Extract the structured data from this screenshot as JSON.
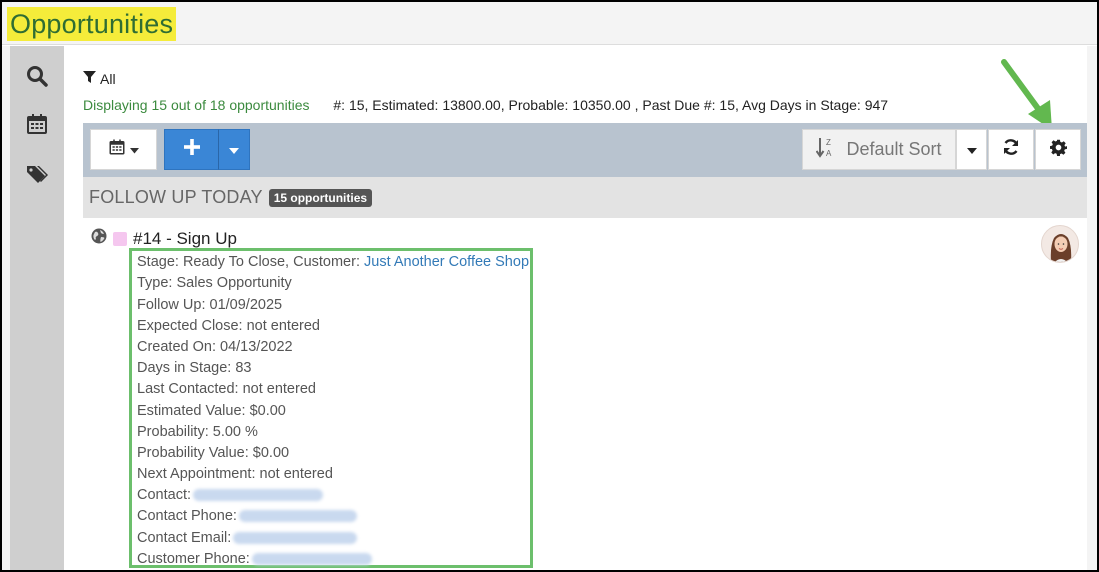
{
  "app": {
    "title": "Opportunities"
  },
  "filter": {
    "label": "All"
  },
  "summary": {
    "count_text": "Displaying 15 out of 18 opportunities",
    "stats_text": "#: 15, Estimated: 13800.00, Probable: 10350.00 , Past Due #: 15, Avg Days in Stage: 947"
  },
  "toolbar": {
    "sort_label": "Default Sort"
  },
  "section": {
    "title": "FOLLOW UP TODAY",
    "badge": "15 opportunities"
  },
  "opportunity": {
    "title": "#14 - Sign Up",
    "stage_prefix": "Stage: Ready To Close, Customer: ",
    "customer_link": "Just Another Coffee Shop",
    "type": "Type: Sales Opportunity",
    "follow_up": "Follow Up: 01/09/2025",
    "expected_close": "Expected Close: not entered",
    "created_on": "Created On: 04/13/2022",
    "days_in_stage": "Days in Stage: 83",
    "last_contacted": "Last Contacted: not entered",
    "estimated_value": "Estimated Value: $0.00",
    "probability": "Probability: 5.00 %",
    "probability_value": "Probability Value: $0.00",
    "next_appointment": "Next Appointment: not entered",
    "contact_label": "Contact:",
    "contact_phone_label": "Contact Phone:",
    "contact_email_label": "Contact Email:",
    "customer_phone_label": "Customer Phone:"
  },
  "colors": {
    "accent_green": "#6cbf6c",
    "title_highlight": "#f5ec3a",
    "primary_blue": "#3a86d6",
    "swatch_pink": "#f5c7ef"
  },
  "icons": {
    "rail": [
      "search-icon",
      "calendar-icon",
      "tags-icon"
    ],
    "toolbar": [
      "calendar-icon",
      "plus-icon",
      "caret-down-icon",
      "sort-alpha-icon",
      "refresh-icon",
      "gear-icon"
    ],
    "filter": "filter-icon",
    "row": "globe-icon"
  }
}
